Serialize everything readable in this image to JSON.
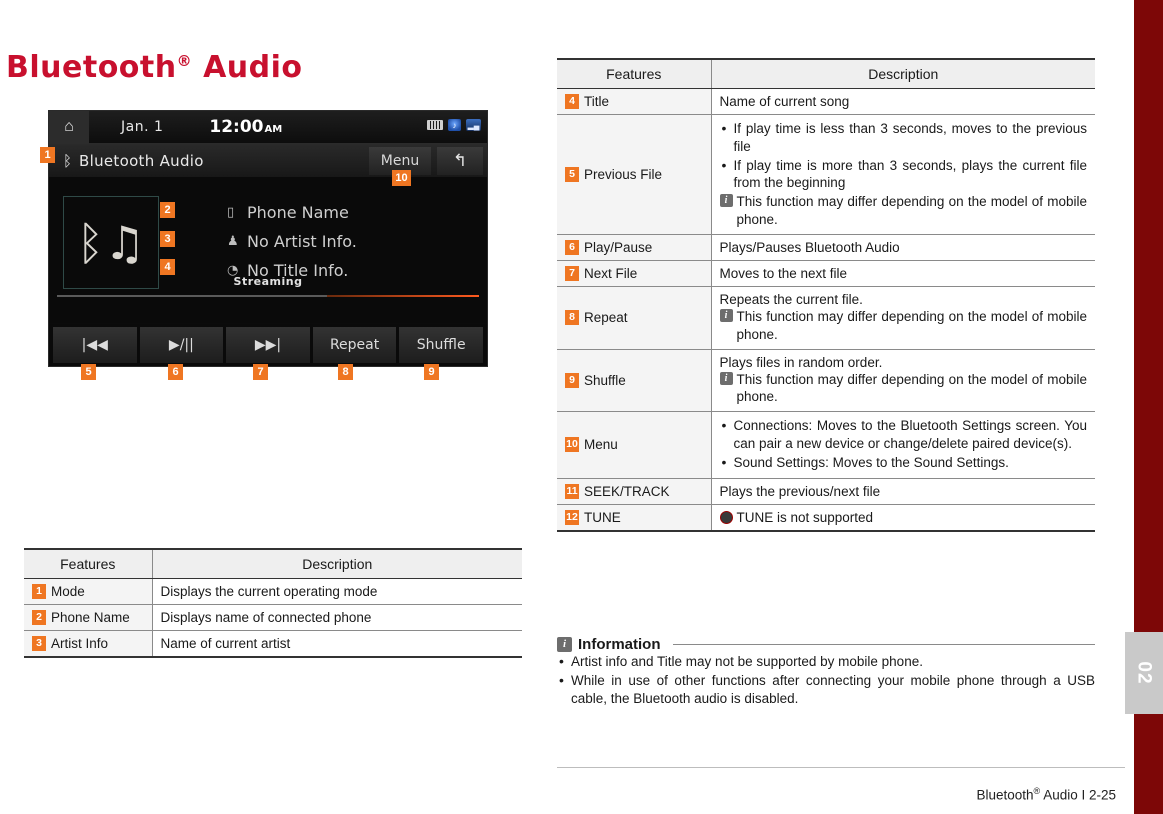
{
  "page": {
    "heading": "Bluetooth",
    "heading_sup": "®",
    "heading_tail": "Audio",
    "chapter_tab": "02",
    "footer": "Bluetooth",
    "footer_sup": "®",
    "footer_tail": "Audio I 2-25",
    "accent_orange": "#ef7622",
    "heading_red": "#c8102e",
    "edge_maroon": "#7d0707"
  },
  "headunit": {
    "home_icon": "home-icon",
    "date": "Jan.  1",
    "time": "12:00",
    "ampm": "AM",
    "status_icons": [
      "battery-icon",
      "bluetooth-audio-status-icon",
      "signal-strength-icon"
    ],
    "mode_icon": "bluetooth-audio-icon",
    "mode_label": "Bluetooth Audio",
    "menu_label": "Menu",
    "back_icon": "back-arrow-icon",
    "album_art_icon": "bluetooth-music-icon",
    "meta": [
      {
        "icon": "phone-icon",
        "text": "Phone Name",
        "badge": "2"
      },
      {
        "icon": "artist-icon",
        "text": "No Artist Info.",
        "badge": "3"
      },
      {
        "icon": "disc-icon",
        "text": "No Title Info.",
        "badge": "4"
      }
    ],
    "status_text": "Streaming",
    "controls": [
      {
        "label": "|◀◀",
        "badge": "5",
        "name": "previous-file-button"
      },
      {
        "label": "▶/||",
        "badge": "6",
        "name": "play-pause-button"
      },
      {
        "label": "▶▶|",
        "badge": "7",
        "name": "next-file-button"
      },
      {
        "label": "Repeat",
        "badge": "8",
        "name": "repeat-button"
      },
      {
        "label": "Shuffle",
        "badge": "9",
        "name": "shuffle-button"
      }
    ],
    "mode_badge": "1",
    "menu_badge": "10"
  },
  "left_table": {
    "headers": [
      "Features",
      "Description"
    ],
    "rows": [
      {
        "num": "1",
        "feature": "Mode",
        "description": "Displays the current operating mode"
      },
      {
        "num": "2",
        "feature": "Phone Name",
        "description": "Displays name of connected phone"
      },
      {
        "num": "3",
        "feature": "Artist Info",
        "description": "Name of current artist"
      }
    ]
  },
  "right_table": {
    "headers": [
      "Features",
      "Description"
    ],
    "rows": [
      {
        "num": "4",
        "feature": "Title",
        "lines": [
          "Name of current song"
        ],
        "bullets": [],
        "note": ""
      },
      {
        "num": "5",
        "feature": "Previous File",
        "lines": [],
        "bullets": [
          "If play time is less than 3 seconds, moves to the previous file",
          "If play time is more than 3 seconds, plays the current file from the beginning"
        ],
        "note": "This function may differ depending on the model of mobile phone."
      },
      {
        "num": "6",
        "feature": "Play/Pause",
        "lines": [
          "Plays/Pauses Bluetooth Audio"
        ],
        "bullets": [],
        "note": ""
      },
      {
        "num": "7",
        "feature": "Next File",
        "lines": [
          "Moves to the next file"
        ],
        "bullets": [],
        "note": ""
      },
      {
        "num": "8",
        "feature": "Repeat",
        "lines": [
          "Repeats the current file."
        ],
        "bullets": [],
        "note": "This function may differ depending on the model of mobile phone."
      },
      {
        "num": "9",
        "feature": "Shuffle",
        "lines": [
          "Plays files in random order."
        ],
        "bullets": [],
        "note": "This function may differ depending on the model of mobile phone."
      },
      {
        "num": "10",
        "feature": "Menu",
        "lines": [],
        "bullets": [
          "Connections: Moves to the Bluetooth Settings screen. You can pair a new device or change/delete paired device(s).",
          "Sound Settings: Moves to the Sound Settings."
        ],
        "note": ""
      },
      {
        "num": "11",
        "feature": "SEEK/TRACK",
        "lines": [
          "Plays the previous/next file"
        ],
        "bullets": [],
        "note": ""
      },
      {
        "num": "12",
        "feature": "TUNE",
        "lines": [],
        "bullets": [],
        "note": "",
        "dot_text": "TUNE is not supported"
      }
    ]
  },
  "information": {
    "badge": "i",
    "title": "Information",
    "items": [
      "Artist info and Title may not be supported by mobile phone.",
      "While in use of other functions after connecting your mobile phone through a USB cable, the Bluetooth audio is disabled."
    ]
  }
}
